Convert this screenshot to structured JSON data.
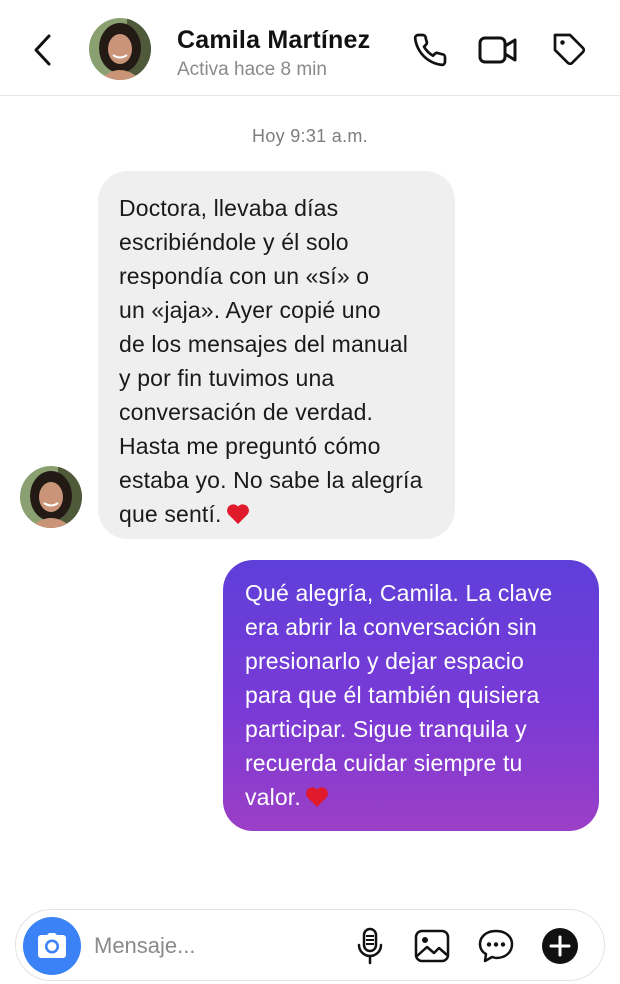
{
  "header": {
    "contact_name": "Camila Martínez",
    "status": "Activa hace 8 min",
    "icons": [
      "back-arrow-icon",
      "phone-icon",
      "video-camera-icon",
      "tag-icon"
    ]
  },
  "conversation": {
    "timestamp": "Hoy 9:31 a.m.",
    "messages": [
      {
        "direction": "incoming",
        "text": "Doctora, llevaba días\nescribiéndole y él solo\nrespondía con un «sí» o\nun «jaja». Ayer copié uno\nde los mensajes del manual\ny por fin tuvimos una\nconversación de verdad.\nHasta me preguntó cómo\nestaba yo. No sabe la alegría\nque sentí.",
        "emoji": "red-heart"
      },
      {
        "direction": "outgoing",
        "text": "Qué alegría, Camila. La clave\nera abrir la conversación sin\npresionarlo y dejar espacio\npara que él también quisiera\nparticipar. Sigue tranquila y\nrecuerda cuidar siempre tu\nvalor.",
        "emoji": "red-heart"
      }
    ]
  },
  "composer": {
    "placeholder": "Mensaje...",
    "value": "",
    "icons": [
      "camera-icon",
      "microphone-icon",
      "image-icon",
      "sticker-chat-icon",
      "plus-icon"
    ]
  },
  "colors": {
    "incoming_bubble": "#efefef",
    "outgoing_gradient_top": "#5f3fd9",
    "outgoing_gradient_bottom": "#9b3fc6",
    "camera_button": "#3b82f6",
    "heart": "#e0192b"
  }
}
